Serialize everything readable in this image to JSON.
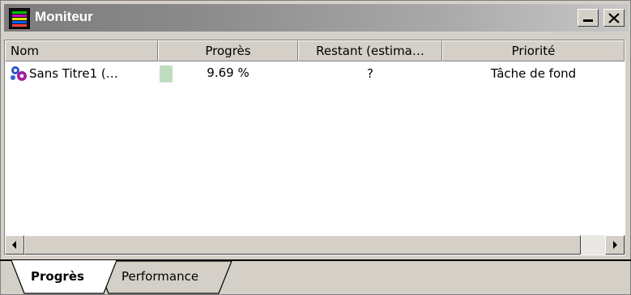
{
  "window": {
    "title": "Moniteur",
    "controls": {
      "minimize_icon": "minimize-icon",
      "close_icon": "close-icon"
    }
  },
  "table": {
    "columns": [
      "Nom",
      "Progrès",
      "Restant (estima…",
      "Priorité"
    ],
    "rows": [
      {
        "icon": "gears-icon",
        "name": "Sans Titre1 (…",
        "progress_text": "9.69 %",
        "progress_fraction": 0.0969,
        "remaining": "?",
        "priority": "Tâche de fond"
      }
    ]
  },
  "tabs": [
    {
      "label": "Progrès",
      "active": true
    },
    {
      "label": "Performance",
      "active": false
    }
  ],
  "colors": {
    "title_bar": "#7c7c7c",
    "face": "#d4d0c8",
    "progress_fill": "#c0dcc0"
  }
}
